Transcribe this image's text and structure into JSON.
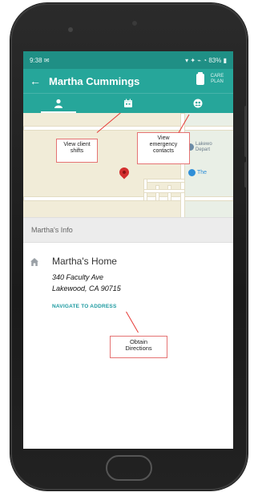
{
  "status_bar": {
    "time": "9:38",
    "left_extra": "✉",
    "right": "▾ ✦ ⌁ ◔ 83% ▮"
  },
  "app_bar": {
    "back_icon": "back-arrow-icon",
    "title": "Martha Cummings",
    "care_plan_label_1": "CARE",
    "care_plan_label_2": "PLAN"
  },
  "tabs": [
    {
      "name": "client",
      "icon": "person-icon"
    },
    {
      "name": "shifts",
      "icon": "calendar-icon"
    },
    {
      "name": "contacts",
      "icon": "emergency-icon"
    }
  ],
  "map": {
    "label_1": "Lakewo",
    "label_2": "Depart",
    "label_3": "The"
  },
  "callouts": {
    "shifts": [
      "View client",
      "shifts"
    ],
    "contacts": [
      "View",
      "emergency",
      "contacts"
    ],
    "directions": [
      "Obtain",
      "Directions"
    ]
  },
  "section": {
    "title": "Martha's Info"
  },
  "address": {
    "title": "Martha's Home",
    "line1": "340 Faculty Ave",
    "line2": "Lakewood, CA  90715",
    "navigate_label": "NAVIGATE TO ADDRESS"
  },
  "colors": {
    "primary": "#26a69a",
    "primary_dark": "#1f8f85",
    "pin": "#d32f2f",
    "callout_border": "#e57373",
    "link": "#1c9aa0"
  }
}
